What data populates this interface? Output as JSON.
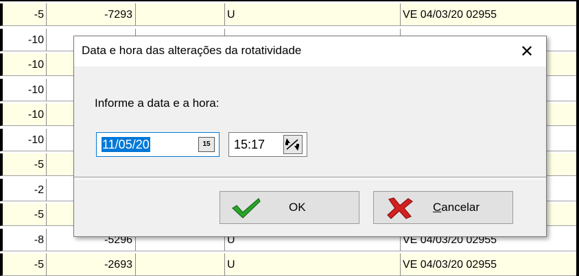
{
  "grid": {
    "rows": [
      {
        "c0": "-5",
        "c1": "-7293",
        "c2": "",
        "c3": "U",
        "c4": "VE 04/03/20 02955",
        "bg": "#ffffe6"
      },
      {
        "c0": "-10",
        "c1": "",
        "c2": "",
        "c3": "",
        "c4": "",
        "bg": "#ffffff"
      },
      {
        "c0": "-10",
        "c1": "",
        "c2": "",
        "c3": "",
        "c4": "",
        "bg": "#ffffe6"
      },
      {
        "c0": "-10",
        "c1": "",
        "c2": "",
        "c3": "",
        "c4": "",
        "bg": "#ffffff"
      },
      {
        "c0": "-10",
        "c1": "",
        "c2": "",
        "c3": "",
        "c4": "",
        "bg": "#ffffe6"
      },
      {
        "c0": "-10",
        "c1": "",
        "c2": "",
        "c3": "",
        "c4": "",
        "bg": "#ffffff"
      },
      {
        "c0": "-5",
        "c1": "",
        "c2": "",
        "c3": "",
        "c4": "",
        "bg": "#ffffe6"
      },
      {
        "c0": "-2",
        "c1": "",
        "c2": "",
        "c3": "",
        "c4": "",
        "bg": "#ffffff"
      },
      {
        "c0": "-5",
        "c1": "",
        "c2": "",
        "c3": "",
        "c4": "",
        "bg": "#ffffe6"
      },
      {
        "c0": "-8",
        "c1": "-5296",
        "c2": "",
        "c3": "U",
        "c4": "VE 04/03/20 02955",
        "bg": "#ffffff"
      },
      {
        "c0": "-5",
        "c1": "-2693",
        "c2": "",
        "c3": "U",
        "c4": "VE 04/03/20 02955",
        "bg": "#ffffe6"
      }
    ]
  },
  "dialog": {
    "title": "Data e hora das alterações da rotatividade",
    "close_symbol": "✕",
    "prompt": "Informe a data e a hora:",
    "date_value": "11/05/20",
    "calendar_icon_text": "15",
    "time_value": "15:17",
    "ok_label": "OK",
    "cancel_label_accel": "C",
    "cancel_label_rest": "ancelar"
  },
  "colors": {
    "row_yellow": "#ffffe6",
    "selection": "#0078d7",
    "ok_check": "#2aa52a",
    "cancel_x": "#d42020"
  },
  "icons": {
    "calendar": "calendar-icon",
    "spin": "spin-updown-icon",
    "ok": "checkmark-icon",
    "cancel": "red-x-icon",
    "close": "close-icon"
  }
}
